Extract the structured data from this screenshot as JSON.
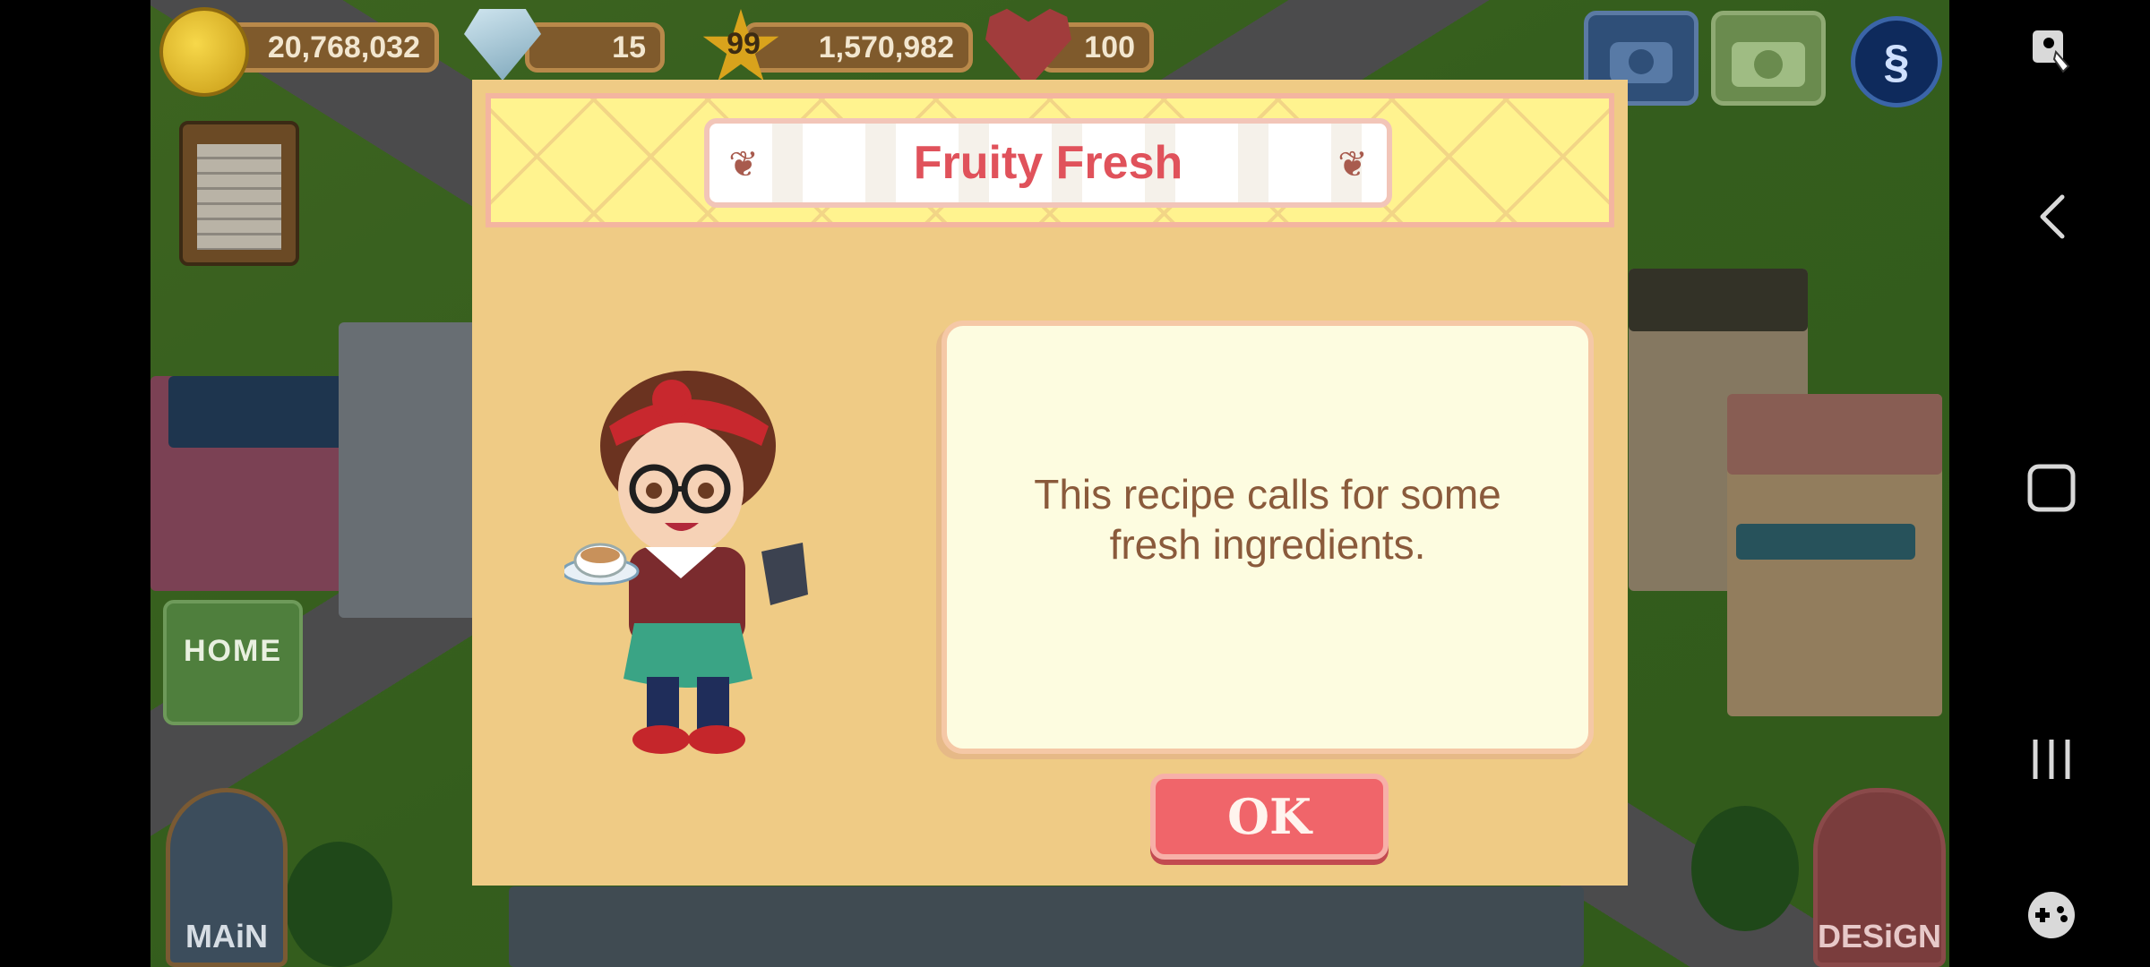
{
  "hud": {
    "coins": "20,768,032",
    "gems": "15",
    "level": "99",
    "xp": "1,570,982",
    "hearts": "100"
  },
  "side_buttons": {
    "home_label": "HOME",
    "main_label": "MAiN",
    "design_label": "DESiGN"
  },
  "dialog": {
    "title": "Fruity Fresh",
    "message": "This recipe calls for some fresh ingredients.",
    "ok_label": "OK"
  },
  "icons": {
    "coin": "coin-icon",
    "gem": "diamond-icon",
    "xp": "star-icon",
    "hearts": "heart-icon",
    "settings": "s-badge-icon"
  },
  "colors": {
    "dialog_bg": "#efcb85",
    "header_bg": "#fff38f",
    "title": "#e0525b",
    "message_text": "#8a5a3b",
    "ok_button": "#f0656a"
  }
}
